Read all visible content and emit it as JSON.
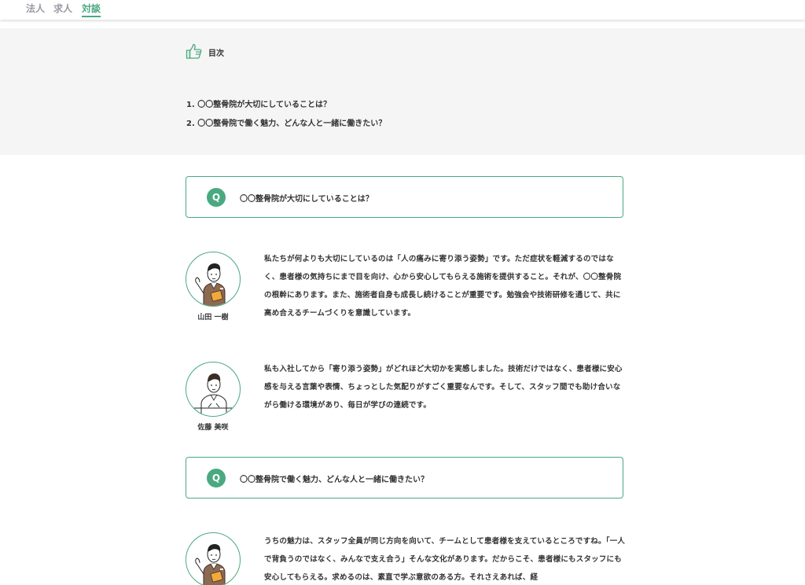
{
  "nav": {
    "items": [
      {
        "label": "法人",
        "active": false
      },
      {
        "label": "求人",
        "active": false
      },
      {
        "label": "対談",
        "active": true
      }
    ]
  },
  "toc": {
    "title": "目次",
    "icon": "thumbs-up-icon",
    "items": [
      "1. 〇〇整骨院が大切にしていることは？",
      "2. 〇〇整骨院で働く魅力、どんな人と一緒に働きたい？"
    ]
  },
  "questions": [
    {
      "badge": "Q",
      "text": "〇〇整骨院が大切にしていることは？"
    },
    {
      "badge": "Q",
      "text": "〇〇整骨院で働く魅力、どんな人と一緒に働きたい？"
    }
  ],
  "speakers": {
    "yamada": "山田 一樹",
    "sato": "佐藤 美咲"
  },
  "answers": {
    "a1": "私たちが何よりも大切にしているのは「人の痛みに寄り添う姿勢」です。ただ症状を軽減するのではなく、患者様の気持ちにまで目を向け、心から安心してもらえる施術を提供すること。それが、〇〇整骨院の根幹にあります。また、施術者自身も成長し続けることが重要です。勉強会や技術研修を通じて、共に高め合えるチームづくりを意識しています。",
    "a2": "私も入社してから「寄り添う姿勢」がどれほど大切かを実感しました。技術だけではなく、患者様に安心感を与える言葉や表情、ちょっとした気配りがすごく重要なんです。そして、スタッフ間でも助け合いながら働ける環境があり、毎日が学びの連続です。",
    "a3": "うちの魅力は、スタッフ全員が同じ方向を向いて、チームとして患者様を支えているところですね。「一人で背負うのではなく、みんなで支え合う」そんな文化があります。だからこそ、患者様にもスタッフにも安心してもらえる。求めるのは、素直で学ぶ意欲のある方。それさえあれば、経"
  },
  "colors": {
    "accent": "#4aa980",
    "toc_bg": "#f5f5f5",
    "text": "#333333"
  }
}
